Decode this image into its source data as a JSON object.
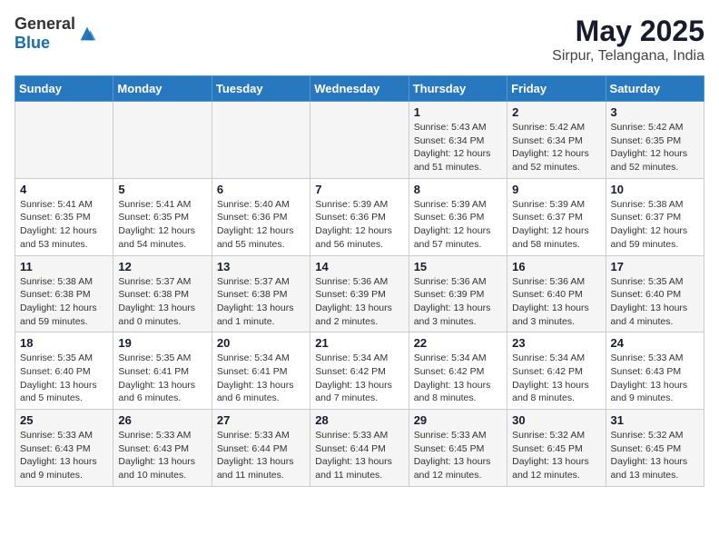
{
  "logo": {
    "general": "General",
    "blue": "Blue"
  },
  "header": {
    "title": "May 2025",
    "subtitle": "Sirpur, Telangana, India"
  },
  "weekdays": [
    "Sunday",
    "Monday",
    "Tuesday",
    "Wednesday",
    "Thursday",
    "Friday",
    "Saturday"
  ],
  "weeks": [
    [
      {
        "day": "",
        "info": ""
      },
      {
        "day": "",
        "info": ""
      },
      {
        "day": "",
        "info": ""
      },
      {
        "day": "",
        "info": ""
      },
      {
        "day": "1",
        "info": "Sunrise: 5:43 AM\nSunset: 6:34 PM\nDaylight: 12 hours\nand 51 minutes."
      },
      {
        "day": "2",
        "info": "Sunrise: 5:42 AM\nSunset: 6:34 PM\nDaylight: 12 hours\nand 52 minutes."
      },
      {
        "day": "3",
        "info": "Sunrise: 5:42 AM\nSunset: 6:35 PM\nDaylight: 12 hours\nand 52 minutes."
      }
    ],
    [
      {
        "day": "4",
        "info": "Sunrise: 5:41 AM\nSunset: 6:35 PM\nDaylight: 12 hours\nand 53 minutes."
      },
      {
        "day": "5",
        "info": "Sunrise: 5:41 AM\nSunset: 6:35 PM\nDaylight: 12 hours\nand 54 minutes."
      },
      {
        "day": "6",
        "info": "Sunrise: 5:40 AM\nSunset: 6:36 PM\nDaylight: 12 hours\nand 55 minutes."
      },
      {
        "day": "7",
        "info": "Sunrise: 5:39 AM\nSunset: 6:36 PM\nDaylight: 12 hours\nand 56 minutes."
      },
      {
        "day": "8",
        "info": "Sunrise: 5:39 AM\nSunset: 6:36 PM\nDaylight: 12 hours\nand 57 minutes."
      },
      {
        "day": "9",
        "info": "Sunrise: 5:39 AM\nSunset: 6:37 PM\nDaylight: 12 hours\nand 58 minutes."
      },
      {
        "day": "10",
        "info": "Sunrise: 5:38 AM\nSunset: 6:37 PM\nDaylight: 12 hours\nand 59 minutes."
      }
    ],
    [
      {
        "day": "11",
        "info": "Sunrise: 5:38 AM\nSunset: 6:38 PM\nDaylight: 12 hours\nand 59 minutes."
      },
      {
        "day": "12",
        "info": "Sunrise: 5:37 AM\nSunset: 6:38 PM\nDaylight: 13 hours\nand 0 minutes."
      },
      {
        "day": "13",
        "info": "Sunrise: 5:37 AM\nSunset: 6:38 PM\nDaylight: 13 hours\nand 1 minute."
      },
      {
        "day": "14",
        "info": "Sunrise: 5:36 AM\nSunset: 6:39 PM\nDaylight: 13 hours\nand 2 minutes."
      },
      {
        "day": "15",
        "info": "Sunrise: 5:36 AM\nSunset: 6:39 PM\nDaylight: 13 hours\nand 3 minutes."
      },
      {
        "day": "16",
        "info": "Sunrise: 5:36 AM\nSunset: 6:40 PM\nDaylight: 13 hours\nand 3 minutes."
      },
      {
        "day": "17",
        "info": "Sunrise: 5:35 AM\nSunset: 6:40 PM\nDaylight: 13 hours\nand 4 minutes."
      }
    ],
    [
      {
        "day": "18",
        "info": "Sunrise: 5:35 AM\nSunset: 6:40 PM\nDaylight: 13 hours\nand 5 minutes."
      },
      {
        "day": "19",
        "info": "Sunrise: 5:35 AM\nSunset: 6:41 PM\nDaylight: 13 hours\nand 6 minutes."
      },
      {
        "day": "20",
        "info": "Sunrise: 5:34 AM\nSunset: 6:41 PM\nDaylight: 13 hours\nand 6 minutes."
      },
      {
        "day": "21",
        "info": "Sunrise: 5:34 AM\nSunset: 6:42 PM\nDaylight: 13 hours\nand 7 minutes."
      },
      {
        "day": "22",
        "info": "Sunrise: 5:34 AM\nSunset: 6:42 PM\nDaylight: 13 hours\nand 8 minutes."
      },
      {
        "day": "23",
        "info": "Sunrise: 5:34 AM\nSunset: 6:42 PM\nDaylight: 13 hours\nand 8 minutes."
      },
      {
        "day": "24",
        "info": "Sunrise: 5:33 AM\nSunset: 6:43 PM\nDaylight: 13 hours\nand 9 minutes."
      }
    ],
    [
      {
        "day": "25",
        "info": "Sunrise: 5:33 AM\nSunset: 6:43 PM\nDaylight: 13 hours\nand 9 minutes."
      },
      {
        "day": "26",
        "info": "Sunrise: 5:33 AM\nSunset: 6:43 PM\nDaylight: 13 hours\nand 10 minutes."
      },
      {
        "day": "27",
        "info": "Sunrise: 5:33 AM\nSunset: 6:44 PM\nDaylight: 13 hours\nand 11 minutes."
      },
      {
        "day": "28",
        "info": "Sunrise: 5:33 AM\nSunset: 6:44 PM\nDaylight: 13 hours\nand 11 minutes."
      },
      {
        "day": "29",
        "info": "Sunrise: 5:33 AM\nSunset: 6:45 PM\nDaylight: 13 hours\nand 12 minutes."
      },
      {
        "day": "30",
        "info": "Sunrise: 5:32 AM\nSunset: 6:45 PM\nDaylight: 13 hours\nand 12 minutes."
      },
      {
        "day": "31",
        "info": "Sunrise: 5:32 AM\nSunset: 6:45 PM\nDaylight: 13 hours\nand 13 minutes."
      }
    ]
  ]
}
